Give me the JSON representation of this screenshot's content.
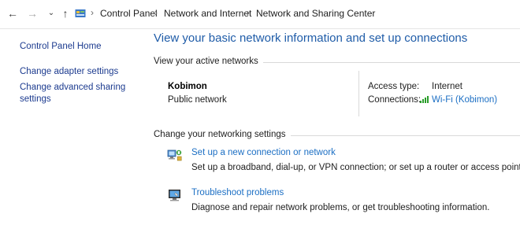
{
  "address_bar": {
    "back_icon": "back-arrow-icon",
    "forward_icon": "forward-arrow-icon",
    "recent_icon": "chevron-down-icon",
    "up_icon": "up-arrow-icon",
    "breadcrumbs": [
      "Control Panel",
      "Network and Internet",
      "Network and Sharing Center"
    ]
  },
  "left_nav": {
    "home": "Control Panel Home",
    "items": [
      "Change adapter settings",
      "Change advanced sharing",
      "settings"
    ]
  },
  "main": {
    "title": "View your basic network information and set up connections",
    "active_networks_label": "View your active networks",
    "network": {
      "name": "Kobimon",
      "type": "Public network",
      "access_type_label": "Access type:",
      "access_type_value": "Internet",
      "connections_label": "Connections:",
      "connection_name": "Wi-Fi (Kobimon)"
    },
    "change_settings_label": "Change your networking settings",
    "tasks": [
      {
        "link": "Set up a new connection or network",
        "description": "Set up a broadband, dial-up, or VPN connection; or set up a router or access point.",
        "icon": "network-setup-icon"
      },
      {
        "link": "Troubleshoot problems",
        "description": "Diagnose and repair network problems, or get troubleshooting information.",
        "icon": "troubleshoot-icon"
      }
    ]
  },
  "colors": {
    "title_blue": "#1f5ca8",
    "link_blue": "#1c6fc4",
    "nav_blue": "#1c3b8f",
    "wifi_green": "#2a9d2a"
  }
}
